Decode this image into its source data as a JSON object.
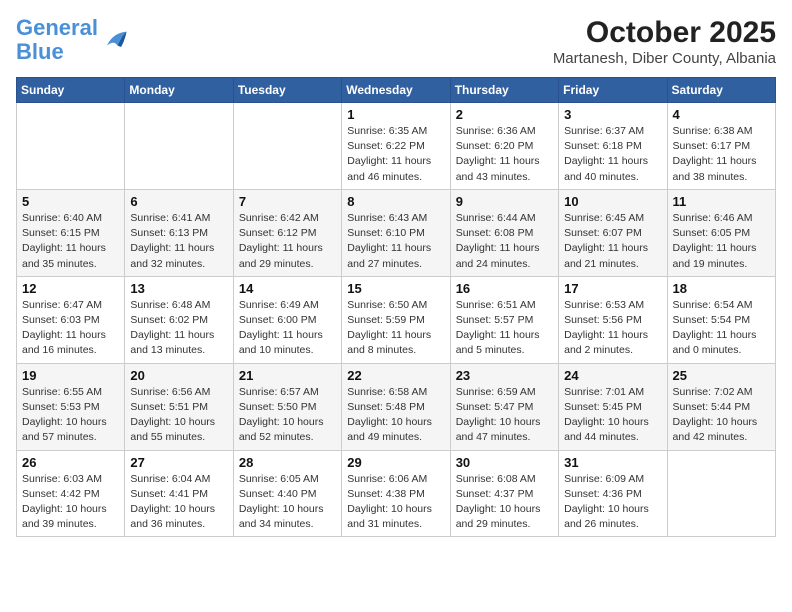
{
  "header": {
    "logo_line1": "General",
    "logo_line2": "Blue",
    "title": "October 2025",
    "subtitle": "Martanesh, Diber County, Albania"
  },
  "days_of_week": [
    "Sunday",
    "Monday",
    "Tuesday",
    "Wednesday",
    "Thursday",
    "Friday",
    "Saturday"
  ],
  "weeks": [
    [
      {
        "day": "",
        "info": ""
      },
      {
        "day": "",
        "info": ""
      },
      {
        "day": "",
        "info": ""
      },
      {
        "day": "1",
        "info": "Sunrise: 6:35 AM\nSunset: 6:22 PM\nDaylight: 11 hours\nand 46 minutes."
      },
      {
        "day": "2",
        "info": "Sunrise: 6:36 AM\nSunset: 6:20 PM\nDaylight: 11 hours\nand 43 minutes."
      },
      {
        "day": "3",
        "info": "Sunrise: 6:37 AM\nSunset: 6:18 PM\nDaylight: 11 hours\nand 40 minutes."
      },
      {
        "day": "4",
        "info": "Sunrise: 6:38 AM\nSunset: 6:17 PM\nDaylight: 11 hours\nand 38 minutes."
      }
    ],
    [
      {
        "day": "5",
        "info": "Sunrise: 6:40 AM\nSunset: 6:15 PM\nDaylight: 11 hours\nand 35 minutes."
      },
      {
        "day": "6",
        "info": "Sunrise: 6:41 AM\nSunset: 6:13 PM\nDaylight: 11 hours\nand 32 minutes."
      },
      {
        "day": "7",
        "info": "Sunrise: 6:42 AM\nSunset: 6:12 PM\nDaylight: 11 hours\nand 29 minutes."
      },
      {
        "day": "8",
        "info": "Sunrise: 6:43 AM\nSunset: 6:10 PM\nDaylight: 11 hours\nand 27 minutes."
      },
      {
        "day": "9",
        "info": "Sunrise: 6:44 AM\nSunset: 6:08 PM\nDaylight: 11 hours\nand 24 minutes."
      },
      {
        "day": "10",
        "info": "Sunrise: 6:45 AM\nSunset: 6:07 PM\nDaylight: 11 hours\nand 21 minutes."
      },
      {
        "day": "11",
        "info": "Sunrise: 6:46 AM\nSunset: 6:05 PM\nDaylight: 11 hours\nand 19 minutes."
      }
    ],
    [
      {
        "day": "12",
        "info": "Sunrise: 6:47 AM\nSunset: 6:03 PM\nDaylight: 11 hours\nand 16 minutes."
      },
      {
        "day": "13",
        "info": "Sunrise: 6:48 AM\nSunset: 6:02 PM\nDaylight: 11 hours\nand 13 minutes."
      },
      {
        "day": "14",
        "info": "Sunrise: 6:49 AM\nSunset: 6:00 PM\nDaylight: 11 hours\nand 10 minutes."
      },
      {
        "day": "15",
        "info": "Sunrise: 6:50 AM\nSunset: 5:59 PM\nDaylight: 11 hours\nand 8 minutes."
      },
      {
        "day": "16",
        "info": "Sunrise: 6:51 AM\nSunset: 5:57 PM\nDaylight: 11 hours\nand 5 minutes."
      },
      {
        "day": "17",
        "info": "Sunrise: 6:53 AM\nSunset: 5:56 PM\nDaylight: 11 hours\nand 2 minutes."
      },
      {
        "day": "18",
        "info": "Sunrise: 6:54 AM\nSunset: 5:54 PM\nDaylight: 11 hours\nand 0 minutes."
      }
    ],
    [
      {
        "day": "19",
        "info": "Sunrise: 6:55 AM\nSunset: 5:53 PM\nDaylight: 10 hours\nand 57 minutes."
      },
      {
        "day": "20",
        "info": "Sunrise: 6:56 AM\nSunset: 5:51 PM\nDaylight: 10 hours\nand 55 minutes."
      },
      {
        "day": "21",
        "info": "Sunrise: 6:57 AM\nSunset: 5:50 PM\nDaylight: 10 hours\nand 52 minutes."
      },
      {
        "day": "22",
        "info": "Sunrise: 6:58 AM\nSunset: 5:48 PM\nDaylight: 10 hours\nand 49 minutes."
      },
      {
        "day": "23",
        "info": "Sunrise: 6:59 AM\nSunset: 5:47 PM\nDaylight: 10 hours\nand 47 minutes."
      },
      {
        "day": "24",
        "info": "Sunrise: 7:01 AM\nSunset: 5:45 PM\nDaylight: 10 hours\nand 44 minutes."
      },
      {
        "day": "25",
        "info": "Sunrise: 7:02 AM\nSunset: 5:44 PM\nDaylight: 10 hours\nand 42 minutes."
      }
    ],
    [
      {
        "day": "26",
        "info": "Sunrise: 6:03 AM\nSunset: 4:42 PM\nDaylight: 10 hours\nand 39 minutes."
      },
      {
        "day": "27",
        "info": "Sunrise: 6:04 AM\nSunset: 4:41 PM\nDaylight: 10 hours\nand 36 minutes."
      },
      {
        "day": "28",
        "info": "Sunrise: 6:05 AM\nSunset: 4:40 PM\nDaylight: 10 hours\nand 34 minutes."
      },
      {
        "day": "29",
        "info": "Sunrise: 6:06 AM\nSunset: 4:38 PM\nDaylight: 10 hours\nand 31 minutes."
      },
      {
        "day": "30",
        "info": "Sunrise: 6:08 AM\nSunset: 4:37 PM\nDaylight: 10 hours\nand 29 minutes."
      },
      {
        "day": "31",
        "info": "Sunrise: 6:09 AM\nSunset: 4:36 PM\nDaylight: 10 hours\nand 26 minutes."
      },
      {
        "day": "",
        "info": ""
      }
    ]
  ]
}
